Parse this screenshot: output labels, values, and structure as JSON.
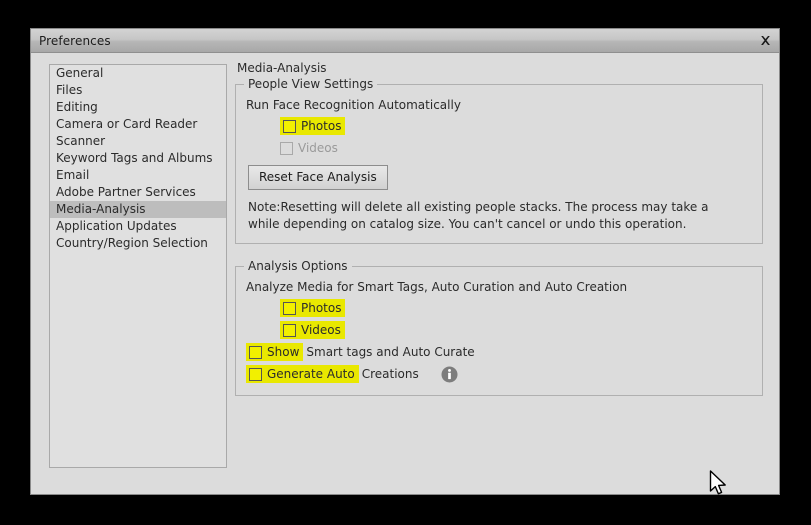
{
  "window": {
    "title": "Preferences",
    "close_icon": "close-icon"
  },
  "sidebar": {
    "items": [
      {
        "label": "General",
        "selected": false
      },
      {
        "label": "Files",
        "selected": false
      },
      {
        "label": "Editing",
        "selected": false
      },
      {
        "label": "Camera or Card Reader",
        "selected": false
      },
      {
        "label": "Scanner",
        "selected": false
      },
      {
        "label": "Keyword Tags and Albums",
        "selected": false
      },
      {
        "label": "Email",
        "selected": false
      },
      {
        "label": "Adobe Partner Services",
        "selected": false
      },
      {
        "label": "Media-Analysis",
        "selected": true
      },
      {
        "label": "Application Updates",
        "selected": false
      },
      {
        "label": "Country/Region Selection",
        "selected": false
      }
    ]
  },
  "main": {
    "heading": "Media-Analysis",
    "people_view": {
      "legend": "People View Settings",
      "description": "Run Face Recognition Automatically",
      "photos_label": "Photos",
      "videos_label": "Videos",
      "reset_button": "Reset Face Analysis",
      "note": "Note:Resetting will delete all existing people stacks. The process may take a while depending on catalog size. You can't cancel or undo this operation."
    },
    "analysis_options": {
      "legend": "Analysis Options",
      "description": "Analyze Media for Smart Tags, Auto Curation and Auto Creation",
      "photos_label": "Photos",
      "videos_label": "Videos",
      "show_label_highlighted": "Show",
      "show_label_rest": "Smart tags and Auto Curate",
      "generate_label_highlighted": "Generate Auto",
      "generate_label_rest": "Creations",
      "info_icon": "info-icon"
    }
  },
  "colors": {
    "highlight": "#e9e800",
    "dialog_bg": "#dcdcdc",
    "selection": "#bdbdbd"
  }
}
